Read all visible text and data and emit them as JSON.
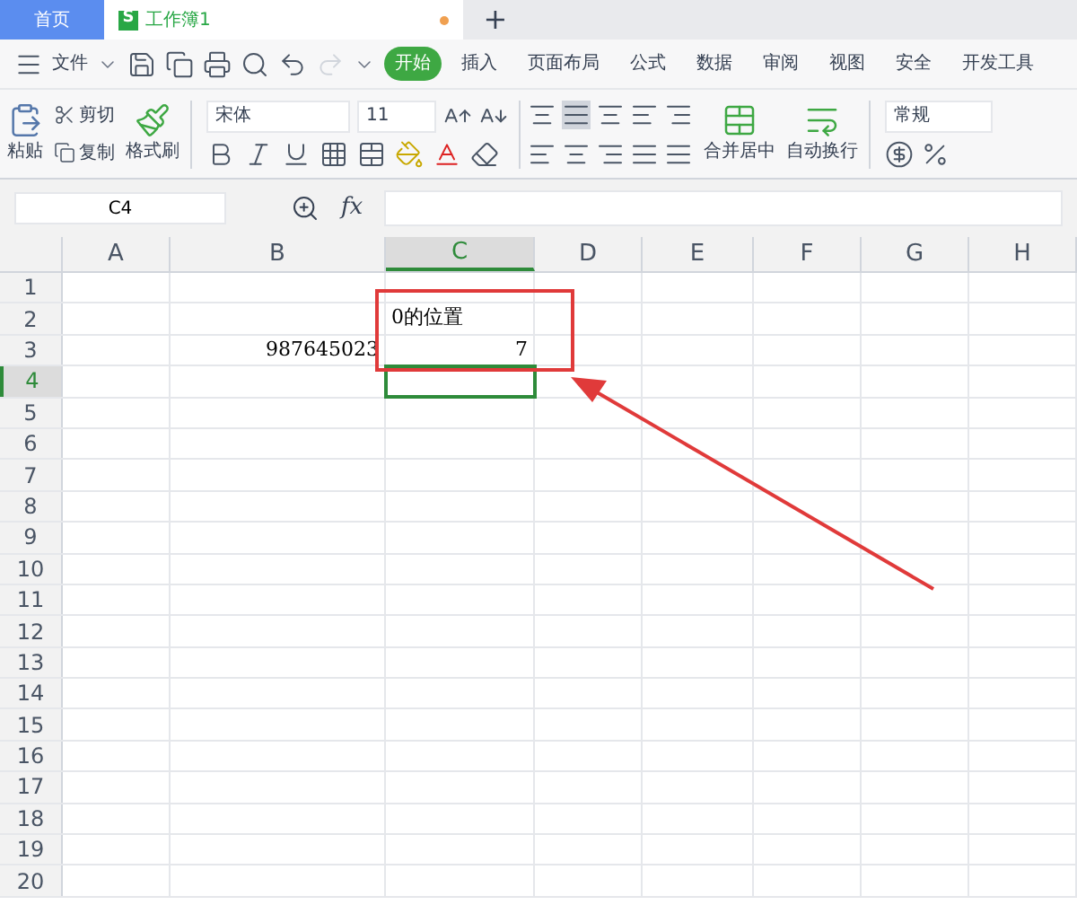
{
  "tabs": [
    {
      "label": "首页",
      "kind": "home",
      "selected": false
    },
    {
      "label": "工作簿1",
      "kind": "doc",
      "badge": "S",
      "unsaved": true,
      "selected": true
    }
  ],
  "new_tab": "+",
  "menu": {
    "file": "文件",
    "ribbon_tabs": [
      {
        "label": "开始",
        "selected": true
      },
      {
        "label": "插入",
        "selected": false
      },
      {
        "label": "页面布局",
        "selected": false
      },
      {
        "label": "公式",
        "selected": false
      },
      {
        "label": "数据",
        "selected": false
      },
      {
        "label": "审阅",
        "selected": false
      },
      {
        "label": "视图",
        "selected": false
      },
      {
        "label": "安全",
        "selected": false
      },
      {
        "label": "开发工具",
        "selected": false
      }
    ]
  },
  "ribbon": {
    "paste": "粘贴",
    "cut": "剪切",
    "copy": "复制",
    "format_painter": "格式刷",
    "font_name": "宋体",
    "font_size": "11",
    "merge_center": "合并居中",
    "wrap_text": "自动换行",
    "number_format": "常规"
  },
  "formula_bar": {
    "name_box": "C4",
    "fx": "fx"
  },
  "grid": {
    "columns": [
      {
        "label": "A",
        "selected": false
      },
      {
        "label": "B",
        "selected": false
      },
      {
        "label": "C",
        "selected": true
      },
      {
        "label": "D",
        "selected": false
      },
      {
        "label": "E",
        "selected": false
      },
      {
        "label": "F",
        "selected": false
      },
      {
        "label": "G",
        "selected": false
      },
      {
        "label": "H",
        "selected": false
      }
    ],
    "rows": [
      {
        "label": "1",
        "selected": false,
        "cells": []
      },
      {
        "label": "2",
        "selected": false,
        "cells": [
          "",
          "",
          {
            "text": "0的位置",
            "kind": "text"
          }
        ]
      },
      {
        "label": "3",
        "selected": false,
        "cells": [
          "",
          {
            "text": "987645023",
            "kind": "number"
          },
          {
            "text": "7",
            "kind": "number"
          }
        ]
      },
      {
        "label": "4",
        "selected": true,
        "cells": []
      },
      {
        "label": "5",
        "selected": false,
        "cells": []
      },
      {
        "label": "6",
        "selected": false,
        "cells": []
      },
      {
        "label": "7",
        "selected": false,
        "cells": []
      },
      {
        "label": "8",
        "selected": false,
        "cells": []
      },
      {
        "label": "9",
        "selected": false,
        "cells": []
      },
      {
        "label": "10",
        "selected": false,
        "cells": []
      },
      {
        "label": "11",
        "selected": false,
        "cells": []
      },
      {
        "label": "12",
        "selected": false,
        "cells": []
      },
      {
        "label": "13",
        "selected": false,
        "cells": []
      },
      {
        "label": "14",
        "selected": false,
        "cells": []
      },
      {
        "label": "15",
        "selected": false,
        "cells": []
      },
      {
        "label": "16",
        "selected": false,
        "cells": []
      },
      {
        "label": "17",
        "selected": false,
        "cells": []
      },
      {
        "label": "18",
        "selected": false,
        "cells": []
      },
      {
        "label": "19",
        "selected": false,
        "cells": []
      },
      {
        "label": "20",
        "selected": false,
        "cells": []
      }
    ]
  }
}
